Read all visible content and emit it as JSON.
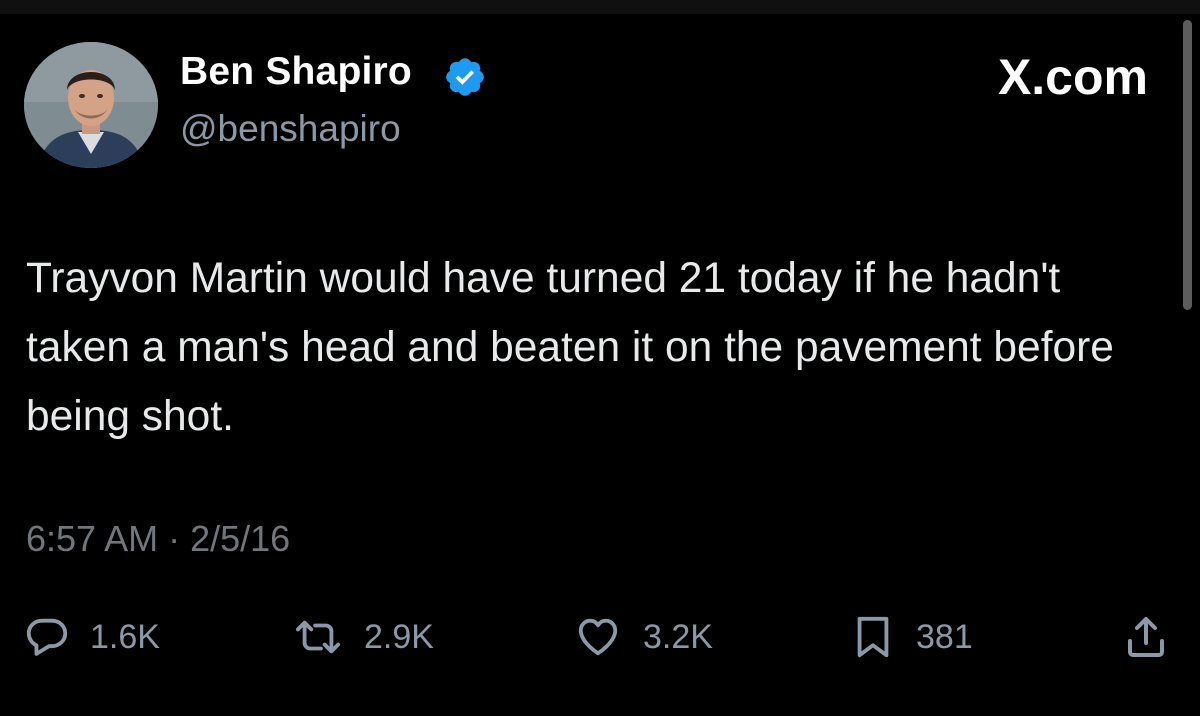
{
  "author": {
    "display_name": "Ben Shapiro",
    "handle": "@benshapiro",
    "verified": true,
    "verified_color": "#1d9bf0"
  },
  "brand": "X.com",
  "tweet": {
    "text": "Trayvon Martin would have turned 21 today if he hadn't taken a man's head and beaten it on the pavement before being shot.",
    "timestamp": "6:57 AM · 2/5/16"
  },
  "actions": {
    "replies": {
      "icon": "reply-icon",
      "count": "1.6K"
    },
    "reposts": {
      "icon": "repost-icon",
      "count": "2.9K"
    },
    "likes": {
      "icon": "heart-icon",
      "count": "3.2K"
    },
    "bookmarks": {
      "icon": "bookmark-icon",
      "count": "381"
    },
    "share": {
      "icon": "share-icon"
    }
  },
  "colors": {
    "background": "#000000",
    "text": "#e7e9ea",
    "muted": "#71767b"
  }
}
